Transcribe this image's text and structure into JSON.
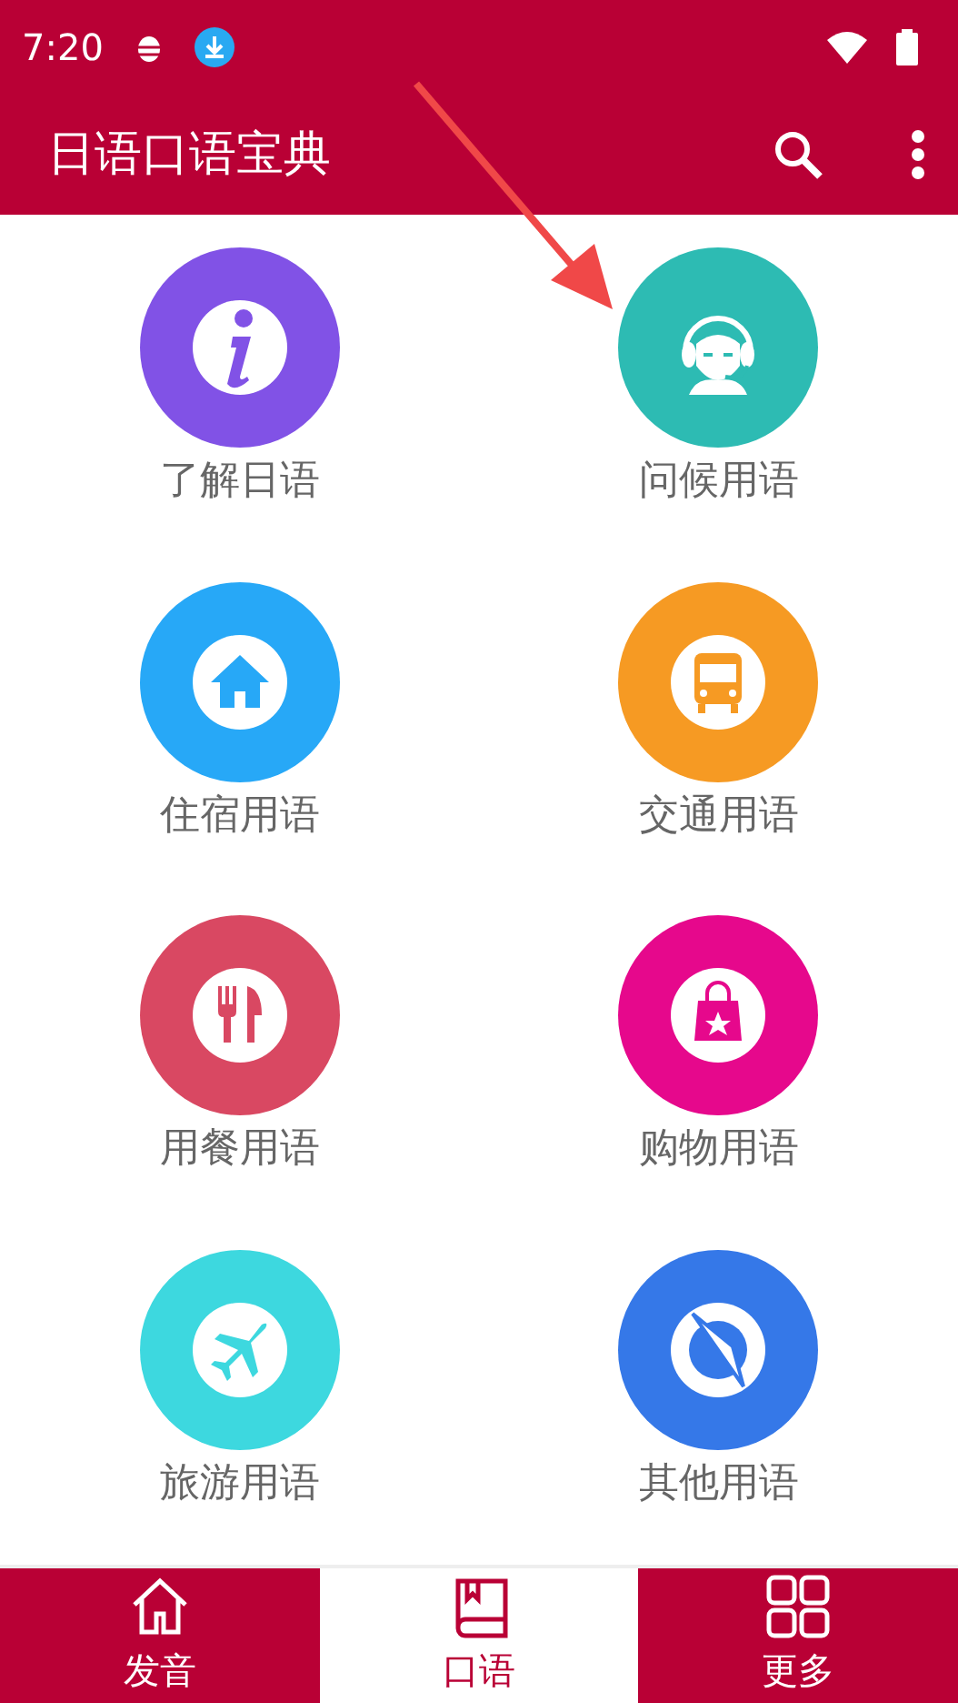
{
  "status_bar": {
    "time": "7:20"
  },
  "app_bar": {
    "title": "日语口语宝典"
  },
  "categories": [
    {
      "label": "了解日语",
      "kind": "info",
      "color": "#8152e6"
    },
    {
      "label": "问候用语",
      "kind": "headset",
      "color": "#2dbbb3"
    },
    {
      "label": "住宿用语",
      "kind": "house",
      "color": "#27a8f7"
    },
    {
      "label": "交通用语",
      "kind": "bus",
      "color": "#f69a23"
    },
    {
      "label": "用餐用语",
      "kind": "dining",
      "color": "#d94862"
    },
    {
      "label": "购物用语",
      "kind": "shopping",
      "color": "#e6088c"
    },
    {
      "label": "旅游用语",
      "kind": "plane",
      "color": "#3dd8df"
    },
    {
      "label": "其他用语",
      "kind": "compass",
      "color": "#3578e8"
    }
  ],
  "bottom_nav": [
    {
      "label": "发音",
      "kind": "home",
      "selected": false
    },
    {
      "label": "口语",
      "kind": "book",
      "selected": true
    },
    {
      "label": "更多",
      "kind": "grid",
      "selected": false
    }
  ]
}
